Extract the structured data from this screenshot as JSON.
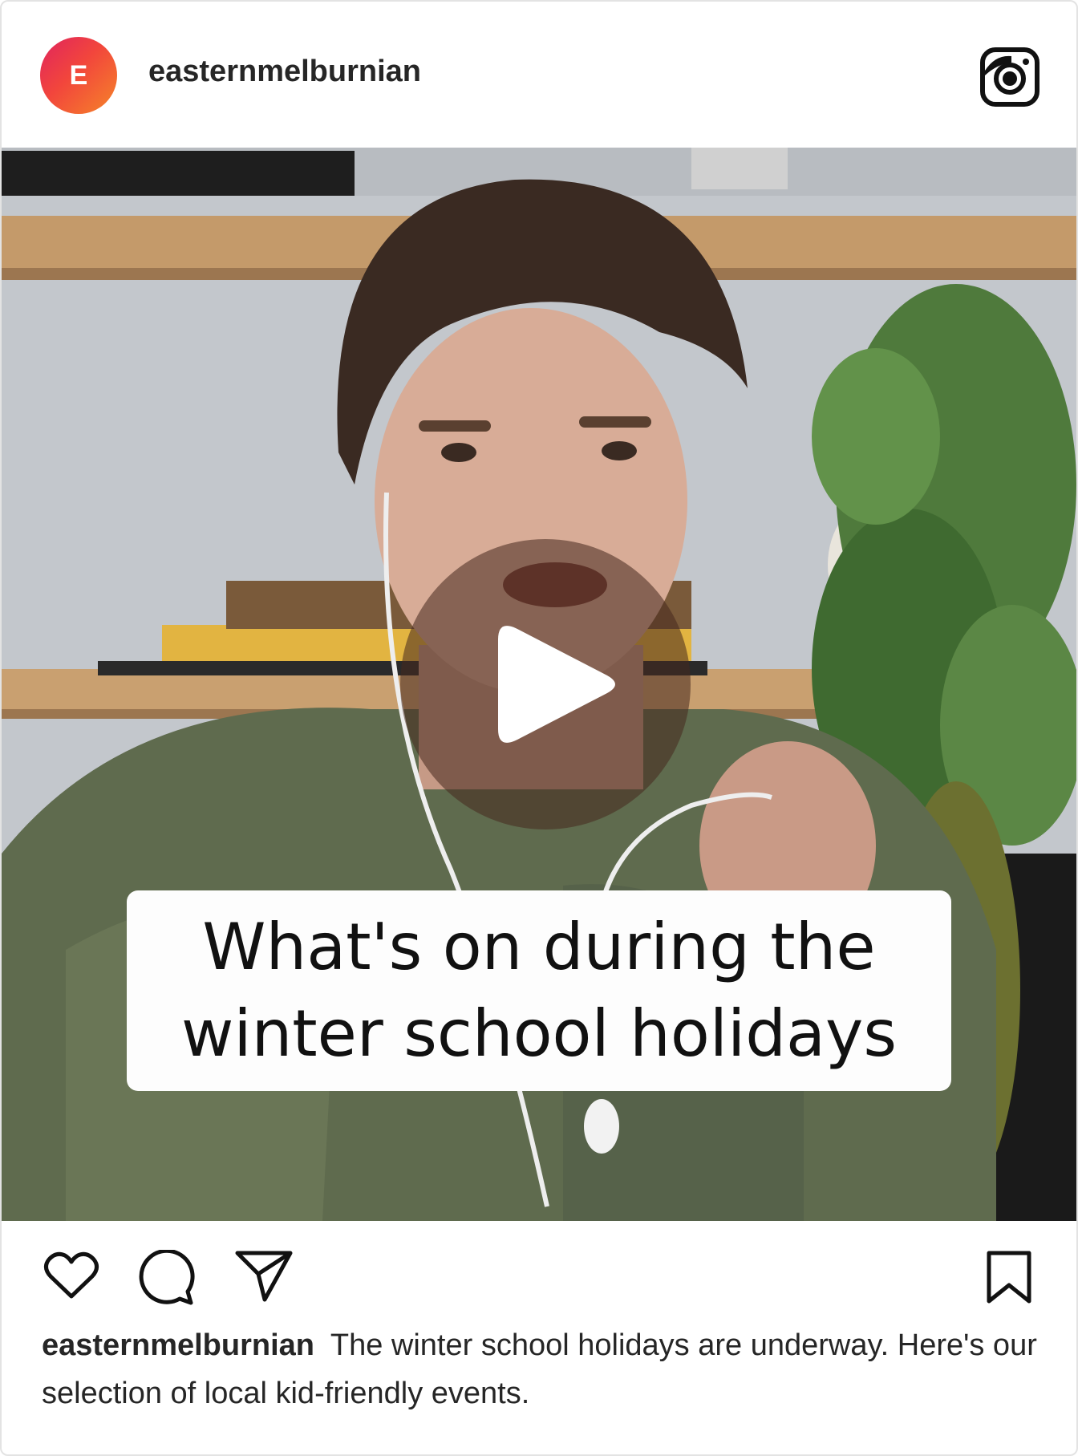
{
  "post": {
    "avatar_letter": "E",
    "username": "easternmelburnian",
    "brand_icon": "instagram-logo-icon",
    "video_overlay": {
      "line1": "What's on during the",
      "line2": "winter school holidays"
    },
    "play_icon": "play-icon",
    "actions": {
      "like_icon": "heart-icon",
      "comment_icon": "comment-icon",
      "share_icon": "send-icon",
      "save_icon": "bookmark-icon"
    },
    "caption": {
      "username": "easternmelburnian",
      "text": "The winter school holidays are underway. Here's our selection of local kid-friendly events."
    }
  }
}
